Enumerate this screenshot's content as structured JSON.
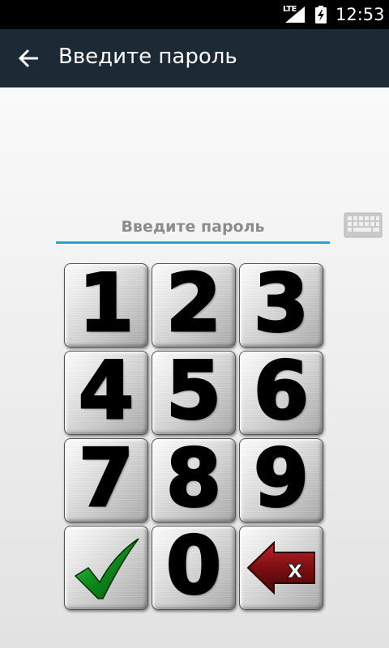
{
  "status_bar": {
    "network_type": "LTE",
    "time": "12:53",
    "signal_icon": "signal-strength-icon",
    "battery_icon": "battery-charging-icon"
  },
  "app_bar": {
    "title": "Введите пароль",
    "back_icon": "arrow-back-icon",
    "background": "#1c2a35"
  },
  "password_field": {
    "placeholder": "Введите пароль",
    "value": "",
    "underline_color": "#27a2d7"
  },
  "keyboard_toggle_icon": "keyboard-icon",
  "keypad": {
    "keys": [
      {
        "label": "1"
      },
      {
        "label": "2"
      },
      {
        "label": "3"
      },
      {
        "label": "4"
      },
      {
        "label": "5"
      },
      {
        "label": "6"
      },
      {
        "label": "7"
      },
      {
        "label": "8"
      },
      {
        "label": "9"
      },
      {
        "label": "0"
      }
    ],
    "confirm_icon": "checkmark-icon",
    "backspace_icon": "backspace-icon",
    "backspace_glyph": "x",
    "confirm_color": "#0e7a1a",
    "backspace_color": "#7a0f12"
  }
}
